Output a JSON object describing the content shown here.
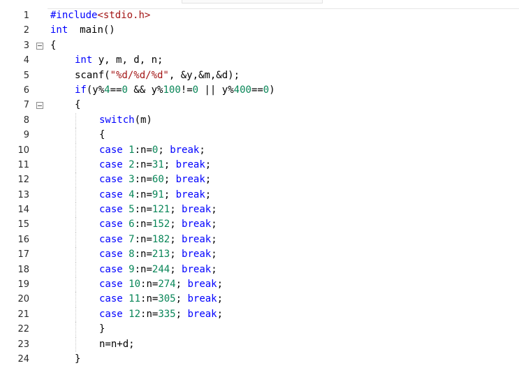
{
  "editor": {
    "lines": [
      {
        "n": "1",
        "fold": false,
        "indent": 0,
        "tokens": [
          [
            "pp",
            "#include"
          ],
          [
            "str",
            "<stdio.h>"
          ]
        ]
      },
      {
        "n": "2",
        "fold": false,
        "indent": 0,
        "tokens": [
          [
            "kw",
            "int"
          ],
          [
            "",
            "  main()"
          ]
        ]
      },
      {
        "n": "3",
        "fold": true,
        "indent": 0,
        "tokens": [
          [
            "",
            "{"
          ]
        ]
      },
      {
        "n": "4",
        "fold": false,
        "indent": 1,
        "tokens": [
          [
            "kw",
            "int"
          ],
          [
            "",
            " y, m, d, n;"
          ]
        ]
      },
      {
        "n": "5",
        "fold": false,
        "indent": 1,
        "tokens": [
          [
            "",
            "scanf("
          ],
          [
            "str",
            "\"%d/%d/%d\""
          ],
          [
            "",
            ", &y,&m,&d);"
          ]
        ]
      },
      {
        "n": "6",
        "fold": false,
        "indent": 1,
        "tokens": [
          [
            "kw",
            "if"
          ],
          [
            "",
            "(y%"
          ],
          [
            "num",
            "4"
          ],
          [
            "",
            "=="
          ],
          [
            "num",
            "0"
          ],
          [
            "",
            " && y%"
          ],
          [
            "num",
            "100"
          ],
          [
            "",
            "!="
          ],
          [
            "num",
            "0"
          ],
          [
            "",
            " || y%"
          ],
          [
            "num",
            "400"
          ],
          [
            "",
            "=="
          ],
          [
            "num",
            "0"
          ],
          [
            "",
            ")"
          ]
        ]
      },
      {
        "n": "7",
        "fold": true,
        "indent": 1,
        "tokens": [
          [
            "",
            "{"
          ]
        ]
      },
      {
        "n": "8",
        "fold": false,
        "indent": 2,
        "tokens": [
          [
            "kw",
            "switch"
          ],
          [
            "",
            "(m)"
          ]
        ]
      },
      {
        "n": "9",
        "fold": false,
        "indent": 2,
        "tokens": [
          [
            "",
            "{"
          ]
        ]
      },
      {
        "n": "10",
        "fold": false,
        "indent": 2,
        "tokens": [
          [
            "kw",
            "case"
          ],
          [
            "",
            " "
          ],
          [
            "num",
            "1"
          ],
          [
            "",
            ":n="
          ],
          [
            "num",
            "0"
          ],
          [
            "",
            "; "
          ],
          [
            "kw",
            "break"
          ],
          [
            "",
            ";"
          ]
        ]
      },
      {
        "n": "11",
        "fold": false,
        "indent": 2,
        "tokens": [
          [
            "kw",
            "case"
          ],
          [
            "",
            " "
          ],
          [
            "num",
            "2"
          ],
          [
            "",
            ":n="
          ],
          [
            "num",
            "31"
          ],
          [
            "",
            "; "
          ],
          [
            "kw",
            "break"
          ],
          [
            "",
            ";"
          ]
        ]
      },
      {
        "n": "12",
        "fold": false,
        "indent": 2,
        "tokens": [
          [
            "kw",
            "case"
          ],
          [
            "",
            " "
          ],
          [
            "num",
            "3"
          ],
          [
            "",
            ":n="
          ],
          [
            "num",
            "60"
          ],
          [
            "",
            "; "
          ],
          [
            "kw",
            "break"
          ],
          [
            "",
            ";"
          ]
        ]
      },
      {
        "n": "13",
        "fold": false,
        "indent": 2,
        "tokens": [
          [
            "kw",
            "case"
          ],
          [
            "",
            " "
          ],
          [
            "num",
            "4"
          ],
          [
            "",
            ":n="
          ],
          [
            "num",
            "91"
          ],
          [
            "",
            "; "
          ],
          [
            "kw",
            "break"
          ],
          [
            "",
            ";"
          ]
        ]
      },
      {
        "n": "14",
        "fold": false,
        "indent": 2,
        "tokens": [
          [
            "kw",
            "case"
          ],
          [
            "",
            " "
          ],
          [
            "num",
            "5"
          ],
          [
            "",
            ":n="
          ],
          [
            "num",
            "121"
          ],
          [
            "",
            "; "
          ],
          [
            "kw",
            "break"
          ],
          [
            "",
            ";"
          ]
        ]
      },
      {
        "n": "15",
        "fold": false,
        "indent": 2,
        "tokens": [
          [
            "kw",
            "case"
          ],
          [
            "",
            " "
          ],
          [
            "num",
            "6"
          ],
          [
            "",
            ":n="
          ],
          [
            "num",
            "152"
          ],
          [
            "",
            "; "
          ],
          [
            "kw",
            "break"
          ],
          [
            "",
            ";"
          ]
        ]
      },
      {
        "n": "16",
        "fold": false,
        "indent": 2,
        "tokens": [
          [
            "kw",
            "case"
          ],
          [
            "",
            " "
          ],
          [
            "num",
            "7"
          ],
          [
            "",
            ":n="
          ],
          [
            "num",
            "182"
          ],
          [
            "",
            "; "
          ],
          [
            "kw",
            "break"
          ],
          [
            "",
            ";"
          ]
        ]
      },
      {
        "n": "17",
        "fold": false,
        "indent": 2,
        "tokens": [
          [
            "kw",
            "case"
          ],
          [
            "",
            " "
          ],
          [
            "num",
            "8"
          ],
          [
            "",
            ":n="
          ],
          [
            "num",
            "213"
          ],
          [
            "",
            "; "
          ],
          [
            "kw",
            "break"
          ],
          [
            "",
            ";"
          ]
        ]
      },
      {
        "n": "18",
        "fold": false,
        "indent": 2,
        "tokens": [
          [
            "kw",
            "case"
          ],
          [
            "",
            " "
          ],
          [
            "num",
            "9"
          ],
          [
            "",
            ":n="
          ],
          [
            "num",
            "244"
          ],
          [
            "",
            "; "
          ],
          [
            "kw",
            "break"
          ],
          [
            "",
            ";"
          ]
        ]
      },
      {
        "n": "19",
        "fold": false,
        "indent": 2,
        "tokens": [
          [
            "kw",
            "case"
          ],
          [
            "",
            " "
          ],
          [
            "num",
            "10"
          ],
          [
            "",
            ":n="
          ],
          [
            "num",
            "274"
          ],
          [
            "",
            "; "
          ],
          [
            "kw",
            "break"
          ],
          [
            "",
            ";"
          ]
        ]
      },
      {
        "n": "20",
        "fold": false,
        "indent": 2,
        "tokens": [
          [
            "kw",
            "case"
          ],
          [
            "",
            " "
          ],
          [
            "num",
            "11"
          ],
          [
            "",
            ":n="
          ],
          [
            "num",
            "305"
          ],
          [
            "",
            "; "
          ],
          [
            "kw",
            "break"
          ],
          [
            "",
            ";"
          ]
        ]
      },
      {
        "n": "21",
        "fold": false,
        "indent": 2,
        "tokens": [
          [
            "kw",
            "case"
          ],
          [
            "",
            " "
          ],
          [
            "num",
            "12"
          ],
          [
            "",
            ":n="
          ],
          [
            "num",
            "335"
          ],
          [
            "",
            "; "
          ],
          [
            "kw",
            "break"
          ],
          [
            "",
            ";"
          ]
        ]
      },
      {
        "n": "22",
        "fold": false,
        "indent": 2,
        "tokens": [
          [
            "",
            "}"
          ]
        ]
      },
      {
        "n": "23",
        "fold": false,
        "indent": 2,
        "tokens": [
          [
            "",
            "n=n+d;"
          ]
        ]
      },
      {
        "n": "24",
        "fold": false,
        "indent": 1,
        "tokens": [
          [
            "",
            "}"
          ]
        ]
      }
    ],
    "colors": {
      "keyword": "#0000ff",
      "number": "#098658",
      "string": "#a31515",
      "text": "#000000",
      "line_number": "#2b2b2b"
    }
  }
}
